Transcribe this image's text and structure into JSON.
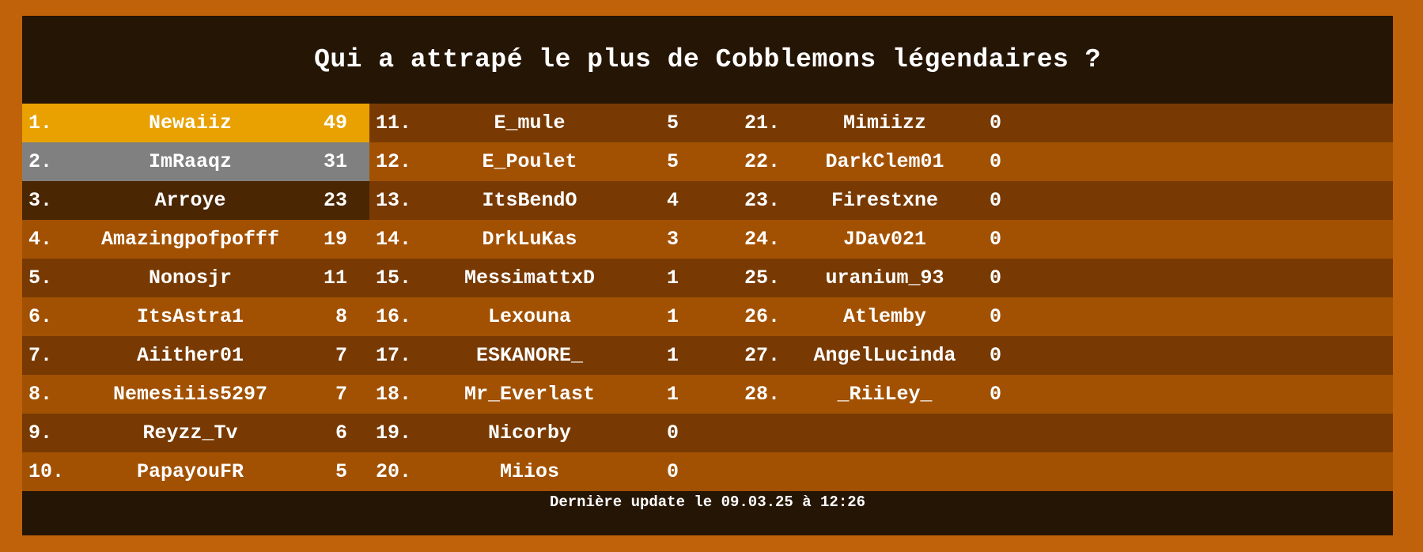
{
  "title": "Qui a attrapé le plus de Cobblemons légendaires ?",
  "colors": {
    "frame": "#c0620a",
    "panel": "#251505",
    "stripe_dark": "#783a02",
    "stripe_light": "#a25102",
    "first_place": "#e8a100",
    "second_place": "#808080",
    "third_place": "#4a2602",
    "text": "#ffffff"
  },
  "leaderboard": [
    {
      "rank": "1.",
      "name": "Newaiiz",
      "score": "49"
    },
    {
      "rank": "2.",
      "name": "ImRaaqz",
      "score": "31"
    },
    {
      "rank": "3.",
      "name": "Arroye",
      "score": "23"
    },
    {
      "rank": "4.",
      "name": "Amazingpofpofff",
      "score": "19"
    },
    {
      "rank": "5.",
      "name": "Nonosjr",
      "score": "11"
    },
    {
      "rank": "6.",
      "name": "ItsAstra1",
      "score": "8"
    },
    {
      "rank": "7.",
      "name": "Aiither01",
      "score": "7"
    },
    {
      "rank": "8.",
      "name": "Nemesiiis5297",
      "score": "7"
    },
    {
      "rank": "9.",
      "name": "Reyzz_Tv",
      "score": "6"
    },
    {
      "rank": "10.",
      "name": "PapayouFR",
      "score": "5"
    },
    {
      "rank": "11.",
      "name": "E_mule",
      "score": "5"
    },
    {
      "rank": "12.",
      "name": "E_Poulet",
      "score": "5"
    },
    {
      "rank": "13.",
      "name": "ItsBendO",
      "score": "4"
    },
    {
      "rank": "14.",
      "name": "DrkLuKas",
      "score": "3"
    },
    {
      "rank": "15.",
      "name": "MessimattxD",
      "score": "1"
    },
    {
      "rank": "16.",
      "name": "Lexouna",
      "score": "1"
    },
    {
      "rank": "17.",
      "name": "ESKANORE_",
      "score": "1"
    },
    {
      "rank": "18.",
      "name": "Mr_Everlast",
      "score": "1"
    },
    {
      "rank": "19.",
      "name": "Nicorby",
      "score": "0"
    },
    {
      "rank": "20.",
      "name": "Miios",
      "score": "0"
    },
    {
      "rank": "21.",
      "name": "Mimiizz",
      "score": "0"
    },
    {
      "rank": "22.",
      "name": "DarkClem01",
      "score": "0"
    },
    {
      "rank": "23.",
      "name": "Firestxne",
      "score": "0"
    },
    {
      "rank": "24.",
      "name": "JDav021",
      "score": "0"
    },
    {
      "rank": "25.",
      "name": "uranium_93",
      "score": "0"
    },
    {
      "rank": "26.",
      "name": "Atlemby",
      "score": "0"
    },
    {
      "rank": "27.",
      "name": "AngelLucinda",
      "score": "0"
    },
    {
      "rank": "28.",
      "name": "_RiiLey_",
      "score": "0"
    }
  ],
  "footer": "Dernière update le 09.03.25 à 12:26"
}
